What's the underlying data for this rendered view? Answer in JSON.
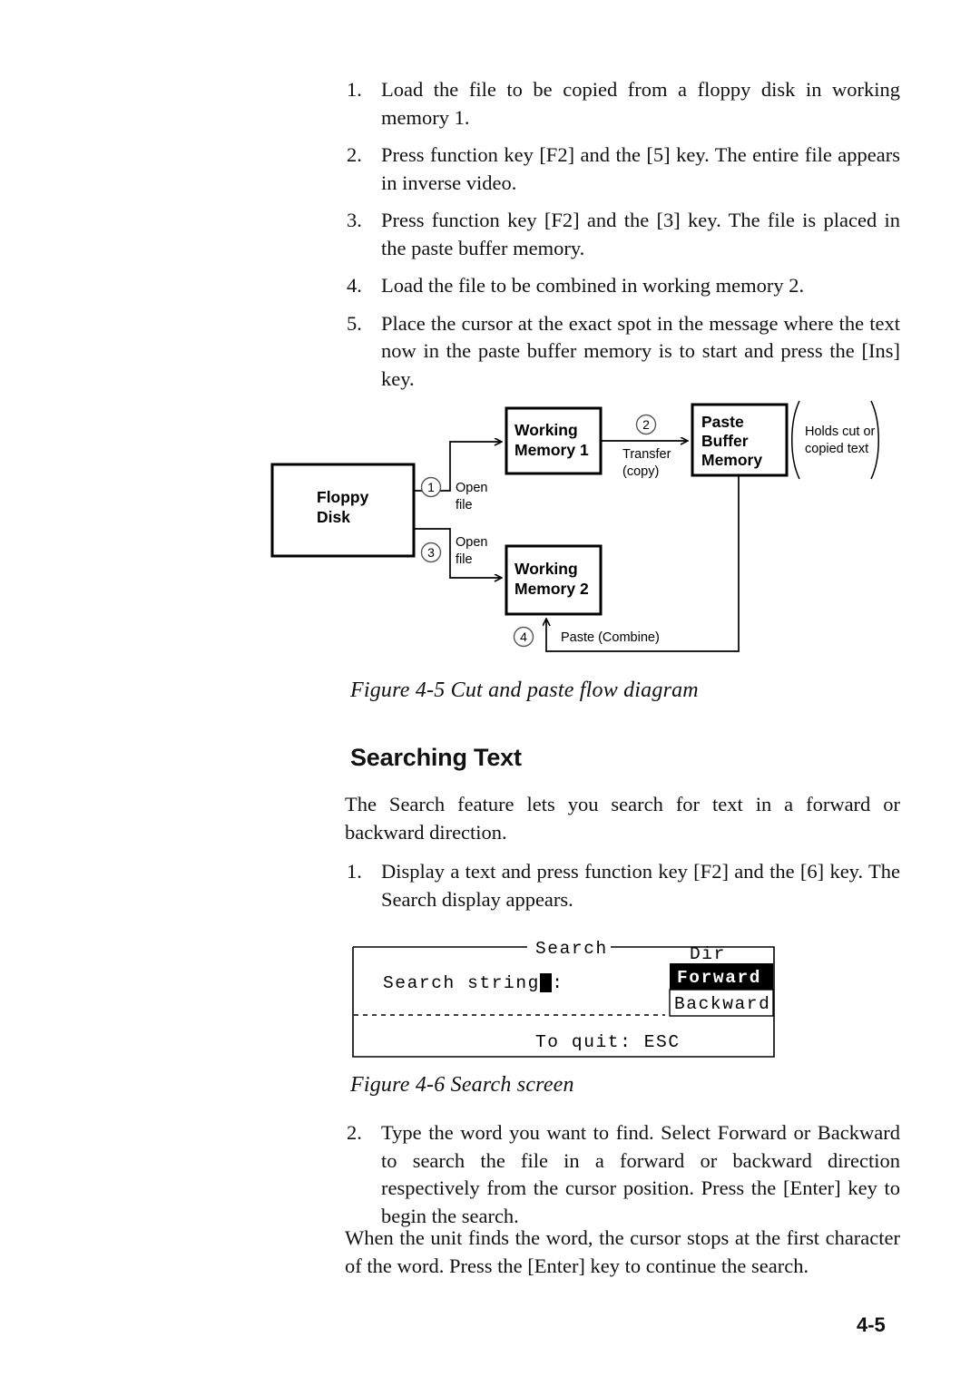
{
  "page": {
    "number": "4-5"
  },
  "steps_cutpaste": [
    {
      "num": "1.",
      "text": "Load the file to be copied from a floppy disk in working memory 1."
    },
    {
      "num": "2.",
      "text": "Press function key [F2] and the [5] key. The entire file appears in inverse video."
    },
    {
      "num": "3.",
      "text": "Press function key [F2] and the [3] key. The file is placed in the paste buffer memory."
    },
    {
      "num": "4.",
      "text": "Load the file to be combined in working memory 2."
    },
    {
      "num": "5.",
      "text": "Place the cursor at the exact spot in the message where the text now in the paste buffer memory is to start and press the [Ins] key."
    }
  ],
  "figure_4_5": {
    "caption": "Figure 4-5 Cut and paste flow diagram",
    "boxes": {
      "floppy_disk": [
        "Floppy",
        "Disk"
      ],
      "working_memory_1": [
        "Working",
        "Memory 1"
      ],
      "working_memory_2": [
        "Working",
        "Memory 2"
      ],
      "paste_buffer": [
        "Paste",
        "Buffer",
        "Memory"
      ]
    },
    "annotations": {
      "bracket_note": [
        "Holds cut or",
        "copied text"
      ],
      "step1_marker": "1",
      "step1_label": [
        "Open",
        "file"
      ],
      "step2_marker": "2",
      "step2_label": [
        "Transfer",
        "(copy)"
      ],
      "step3_marker": "3",
      "step3_label": [
        "Open",
        "file"
      ],
      "step4_marker": "4",
      "step4_label": "Paste (Combine)"
    }
  },
  "searching_text": {
    "heading": "Searching Text",
    "intro": "The Search feature lets you search for text in a forward or backward direction.",
    "step1": {
      "num": "1.",
      "text": "Display a text and press function key [F2] and the [6] key. The Search display appears."
    },
    "step2": {
      "num": "2.",
      "text": "Type the word you want to find. Select Forward or Backward to search the file in a forward or backward direction respectively from the cursor position. Press the [Enter] key to begin the search."
    },
    "closing": "When the unit finds the word, the cursor stops at the first character of the word. Press the [Enter] key to continue the search."
  },
  "figure_4_6": {
    "caption": "Figure 4-6 Search screen",
    "screen": {
      "title": "Search",
      "field_label": "Search string :",
      "field_value": "",
      "cursor": "block-cursor",
      "dir_label": "Dir",
      "dir_options": [
        {
          "label": "Forward",
          "selected": true
        },
        {
          "label": "Backward",
          "selected": false
        }
      ],
      "footer": "To quit: ESC"
    }
  },
  "colors": {
    "ink": "#111111",
    "paper": "#ffffff",
    "highlight_bg": "#000000",
    "highlight_fg": "#ffffff"
  }
}
